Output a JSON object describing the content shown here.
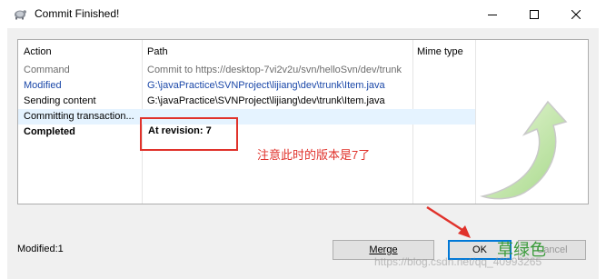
{
  "window": {
    "title": "Commit Finished!"
  },
  "table": {
    "headers": {
      "action": "Action",
      "path": "Path",
      "mime": "Mime type"
    },
    "rows": [
      {
        "action": "Command",
        "path": "Commit to https://desktop-7vi2v2u/svn/helloSvn/dev/trunk"
      },
      {
        "action": "Modified",
        "path": "G:\\javaPractice\\SVNProject\\lijiang\\dev\\trunk\\Item.java"
      },
      {
        "action": "Sending content",
        "path": "G:\\javaPractice\\SVNProject\\lijiang\\dev\\trunk\\Item.java"
      },
      {
        "action": "Committing transaction...",
        "path": ""
      },
      {
        "action": "Completed",
        "path": "At revision: 7"
      }
    ]
  },
  "status": {
    "modified": "Modified:1"
  },
  "buttons": {
    "merge": "Merge",
    "ok": "OK",
    "cancel": "Cancel"
  },
  "annotations": {
    "note": "注意此时的版本是7了",
    "green_label": "草绿色"
  },
  "watermark": "https://blog.csdn.net/qq_40993265",
  "colors": {
    "annotation_red": "#e0322b",
    "annotation_green": "#3a9b3a",
    "selected_row": "#e5f3ff",
    "modified_blue": "#1a47a8"
  }
}
